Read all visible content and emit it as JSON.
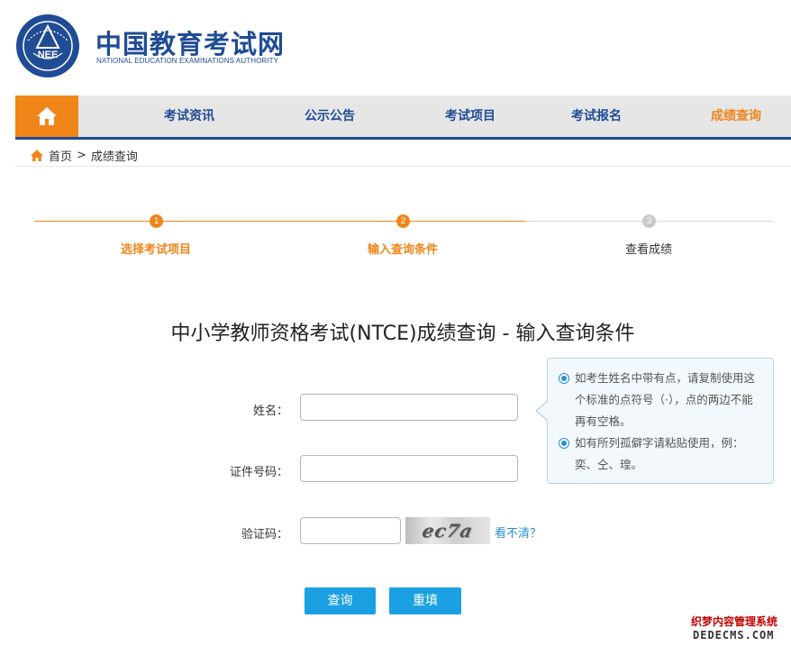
{
  "header": {
    "logo_badge_text": "NEE",
    "site_name_cn": "中国教育考试网",
    "site_name_en": "NATIONAL EDUCATION EXAMINATIONS AUTHORITY"
  },
  "nav": {
    "home_icon": "home-icon",
    "items": [
      {
        "label": "考试资讯",
        "active": false
      },
      {
        "label": "公示公告",
        "active": false
      },
      {
        "label": "考试项目",
        "active": false
      },
      {
        "label": "考试报名",
        "active": false
      },
      {
        "label": "成绩查询",
        "active": true
      }
    ]
  },
  "breadcrumb": {
    "home": "首页",
    "separator": ">",
    "current": "成绩查询"
  },
  "steps": [
    {
      "number": "1",
      "label": "选择考试项目",
      "state": "done"
    },
    {
      "number": "2",
      "label": "输入查询条件",
      "state": "current"
    },
    {
      "number": "3",
      "label": "查看成绩",
      "state": "pending"
    }
  ],
  "form": {
    "title": "中小学教师资格考试(NTCE)成绩查询 - 输入查询条件",
    "name_label": "姓名：",
    "name_value": "",
    "id_label": "证件号码：",
    "id_value": "",
    "captcha_label": "验证码：",
    "captcha_value": "",
    "captcha_image_text": "ec7a",
    "refresh_link": "看不清？",
    "submit_label": "查询",
    "reset_label": "重填"
  },
  "tips": [
    "如考生姓名中带有点，请复制使用这个标准的点符号（·），点的两边不能再有空格。",
    "如有所列孤僻字请粘贴使用，例：奕、仝、瑝。"
  ],
  "watermark": {
    "cn": "织梦内容管理系统",
    "en": "DEDECMS.COM"
  },
  "colors": {
    "brand_blue": "#1f4c94",
    "accent_orange": "#f08519",
    "button_blue": "#1ba1e2",
    "link_blue": "#2a8fd0",
    "pending_gray": "#c8c8c8"
  }
}
